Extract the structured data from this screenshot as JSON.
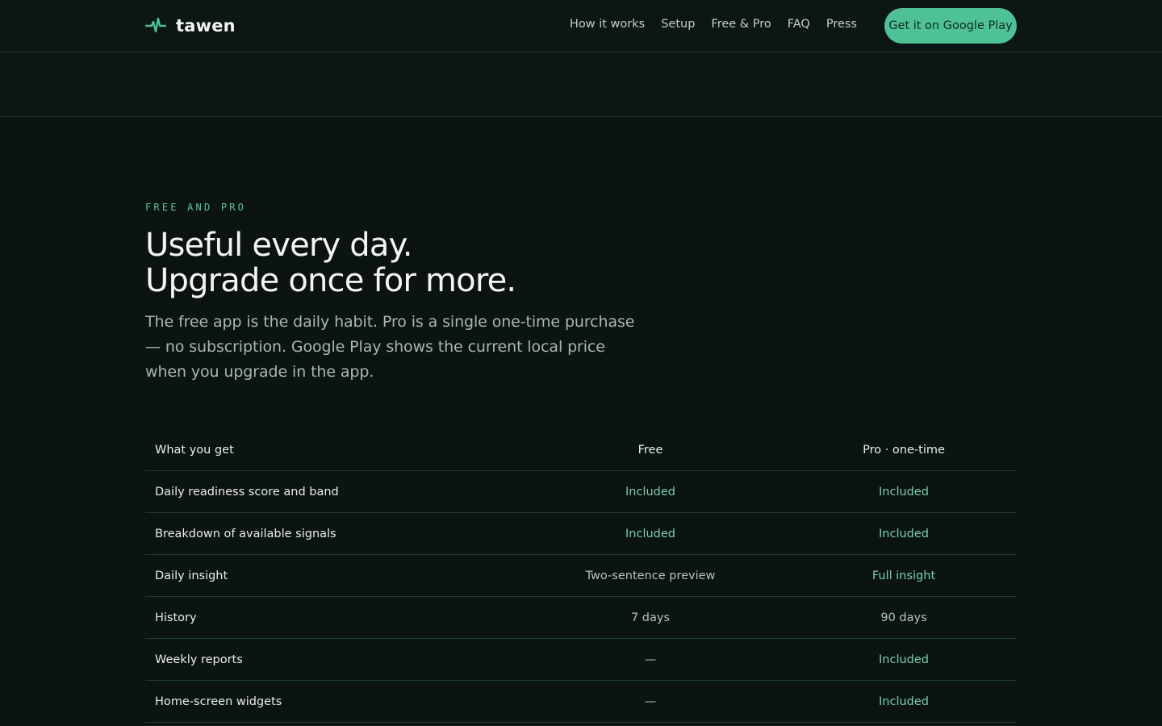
{
  "brand": {
    "name": "tawen",
    "accent": "#4fc196"
  },
  "nav": {
    "items": [
      {
        "label": "How it works"
      },
      {
        "label": "Setup"
      },
      {
        "label": "Free & Pro"
      },
      {
        "label": "FAQ"
      },
      {
        "label": "Press"
      }
    ],
    "cta_label": "Get it on Google Play"
  },
  "section": {
    "eyebrow": "FREE AND PRO",
    "headline_line1": "Useful every day.",
    "headline_line2": "Upgrade once for more.",
    "lede": "The free app is the daily habit. Pro is a single one-time purchase — no subscription. Google Play shows the current local price when you upgrade in the app."
  },
  "table": {
    "headers": [
      "What you get",
      "Free",
      "Pro · one-time"
    ],
    "rows": [
      {
        "feature": "Daily readiness score and band",
        "free": "Included",
        "pro": "Included"
      },
      {
        "feature": "Breakdown of available signals",
        "free": "Included",
        "pro": "Included"
      },
      {
        "feature": "Daily insight",
        "free": "Two-sentence preview",
        "pro": "Full insight"
      },
      {
        "feature": "History",
        "free": "7 days",
        "pro": "90 days"
      },
      {
        "feature": "Weekly reports",
        "free": "—",
        "pro": "Included"
      },
      {
        "feature": "Home-screen widgets",
        "free": "—",
        "pro": "Included"
      }
    ]
  }
}
